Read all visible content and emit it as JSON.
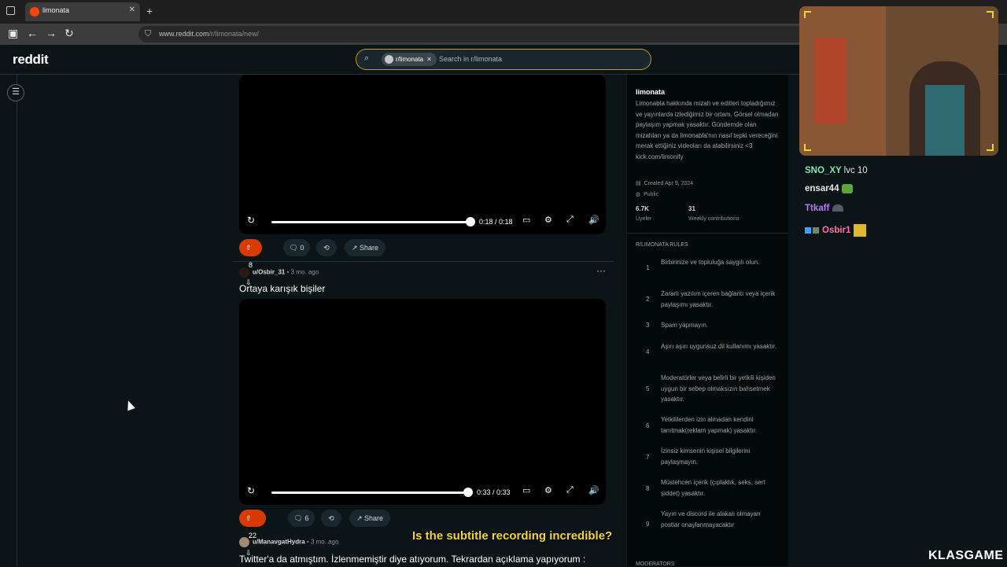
{
  "browser": {
    "tab_title": "limonata",
    "url_prefix": "www.reddit.com",
    "url_path": "/r/limonata/new/"
  },
  "header": {
    "logo": "reddit",
    "search_chip": "r/limonata",
    "search_placeholder": "Search in r/limonata"
  },
  "posts": [
    {
      "time": "0:18 / 0:18",
      "progress": 1.0,
      "votes": "8",
      "comments": "0",
      "share": "Share"
    },
    {
      "user": "u/Osbir_31",
      "age": "• 3 mo. ago",
      "title": "Ortaya karışık bişiler",
      "time": "0:33 / 0:33",
      "progress": 1.0,
      "votes": "22",
      "comments": "6",
      "share": "Share"
    },
    {
      "user": "u/ManavgatHydra",
      "age": "• 3 mo. ago",
      "title": "Twitter'a da atmıştım. İzlenmemiştir diye atıyorum. Tekrardan açıklama yapıyorum :"
    }
  ],
  "sidebar": {
    "name": "limonata",
    "description": "Limonabla hakkında mizah ve editleri topladığımız ve yayınlarda izlediğimiz bir ortam. Görsel olmadan paylaşım yapmak yasaktır. Gündemde olan mizahları ya da limonabla'nın nasıl tepki vereceğini merak ettiğiniz videoları da atabilirsiniz <3 kick.com/limonify",
    "created": "Created Apr 9, 2024",
    "visibility": "Public",
    "stat1_value": "6.7K",
    "stat1_label": "Üyeler",
    "stat2_value": "31",
    "stat2_label": "Weekly contributions",
    "rules_header": "R/LIMONATA RULES",
    "rules": [
      {
        "n": "1",
        "text": "Birbirinize ve topluluğa saygılı olun."
      },
      {
        "n": "2",
        "text": "Zararlı yazılım içeren bağlantı veya içerik paylaşımı yasaktır."
      },
      {
        "n": "3",
        "text": "Spam yapmayın."
      },
      {
        "n": "4",
        "text": "Aşırı aşırı uygunsuz dil kullanımı yasaktır."
      },
      {
        "n": "5",
        "text": "Moderatörler veya belirli bir yetkili kişiden uygun bir sebep olmaksızın bahsetmek yasaktır."
      },
      {
        "n": "6",
        "text": "Yetkililerden izin almadan kendini tanıtmak(reklam yapmak) yasaktır."
      },
      {
        "n": "7",
        "text": "İzinsiz kimsenin kişisel bilgilerini paylaşmayın."
      },
      {
        "n": "8",
        "text": "Müstehcen içerik (çıplaklık, seks, sert şiddet) yasaktır."
      },
      {
        "n": "9",
        "text": "Yayın ve discord ile alakalı olmayan postlar onaylanmayacaktır"
      }
    ],
    "moderators_header": "MODERATORS"
  },
  "overlay": {
    "chat": [
      {
        "user": "SNO_XY",
        "msg": "lvc 10",
        "color": "#7ee8b0"
      },
      {
        "user": "ensar44",
        "msg": "",
        "color": "#e8e8e8"
      },
      {
        "user": "Ttkaff",
        "msg": "",
        "color": "#b57cf2"
      },
      {
        "user": "Osbir1",
        "msg": "",
        "color": "#ff6fa8"
      }
    ],
    "subtitle": "Is the subtitle recording incredible?",
    "brand": "KLASGAME"
  }
}
